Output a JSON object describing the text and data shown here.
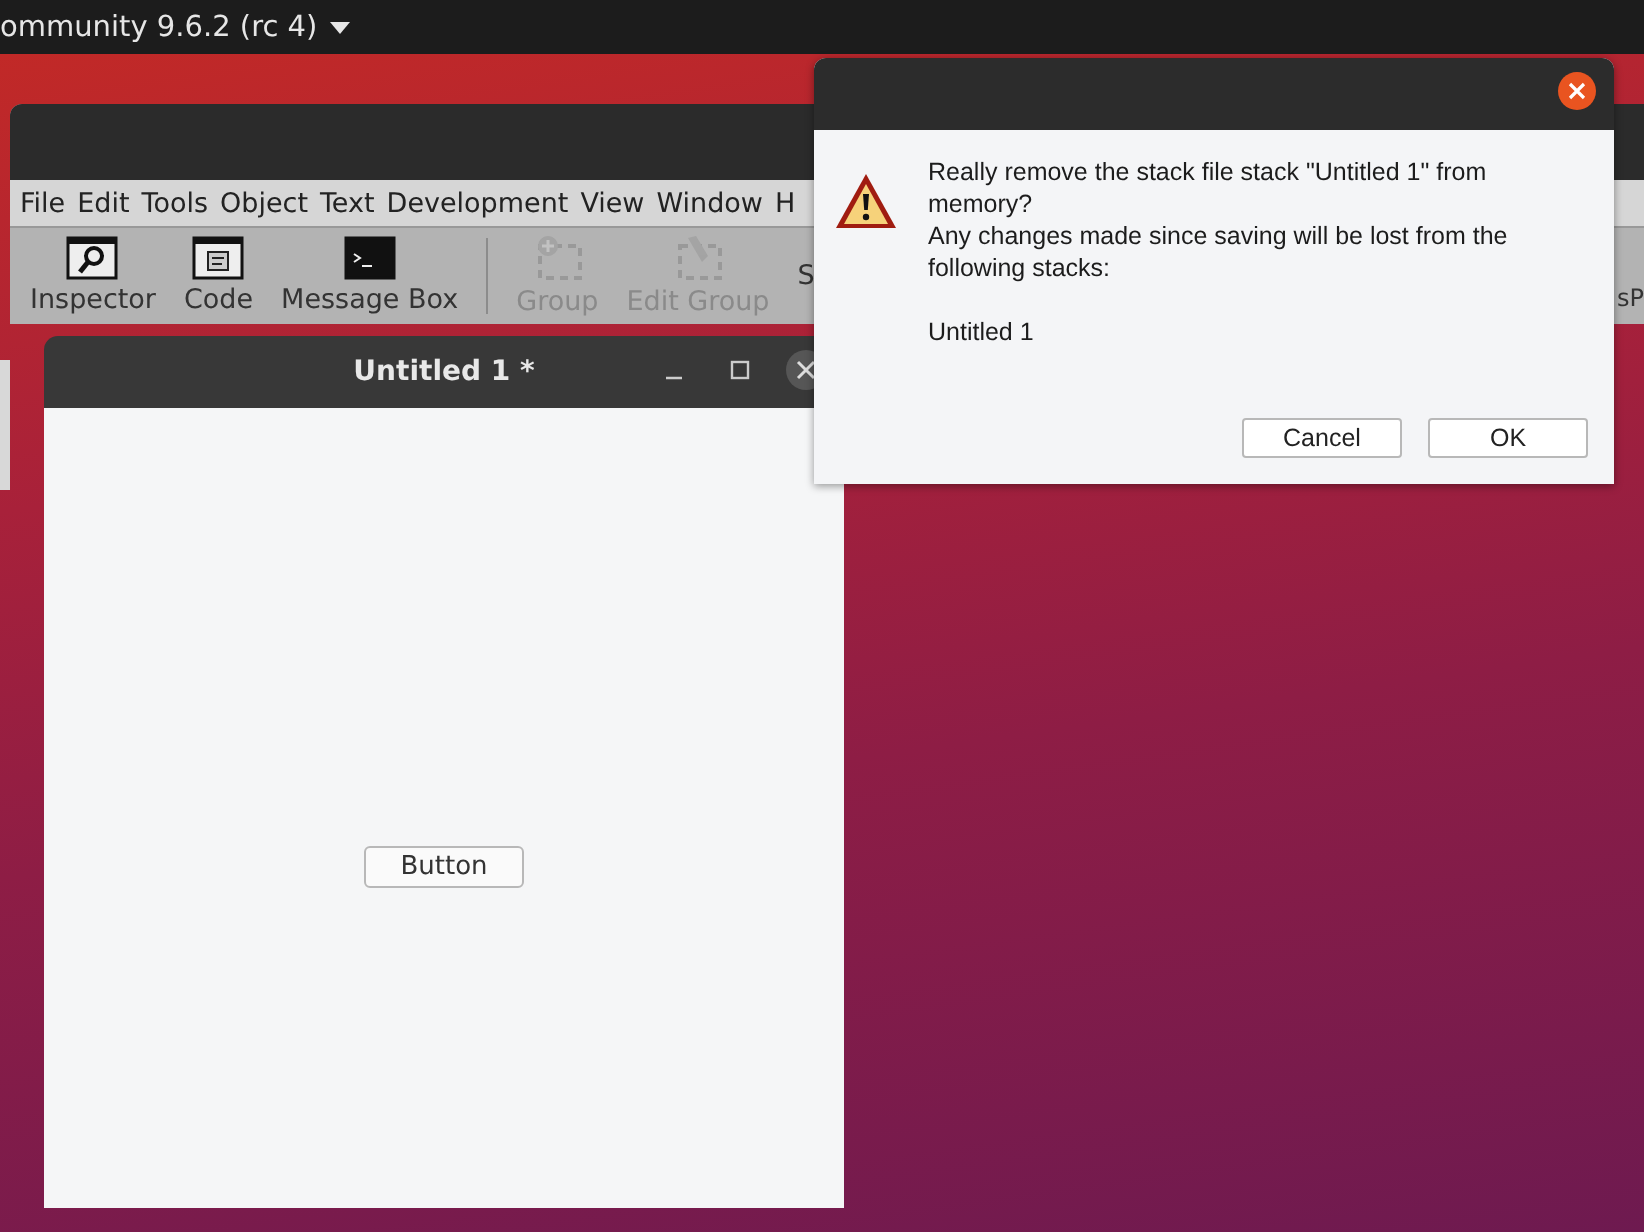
{
  "top_bar": {
    "app_menu": "ommunity 9.6.2 (rc 4)"
  },
  "ide_window": {
    "menu": [
      "File",
      "Edit",
      "Tools",
      "Object",
      "Text",
      "Development",
      "View",
      "Window",
      "H"
    ],
    "toolbar": [
      {
        "label": "Inspector",
        "kind": "inspector",
        "disabled": false
      },
      {
        "label": "Code",
        "kind": "code",
        "disabled": false
      },
      {
        "label": "Message Box",
        "kind": "terminal",
        "disabled": false
      },
      {
        "kind": "separator"
      },
      {
        "label": "Group",
        "kind": "group",
        "disabled": true
      },
      {
        "label": "Edit Group",
        "kind": "edit-group",
        "disabled": true
      },
      {
        "label": "S",
        "kind": "text",
        "disabled": false
      }
    ],
    "toolbar_right": [
      "s",
      "P"
    ]
  },
  "stack_window": {
    "title": "Untitled 1 *",
    "button": "Button"
  },
  "dialog": {
    "paragraphs": [
      "Really remove the stack file stack \"Untitled 1\" from memory?",
      "Any changes made since saving will be lost from the following stacks:"
    ],
    "stacks": "Untitled 1",
    "buttons": [
      "Cancel",
      "OK"
    ]
  }
}
